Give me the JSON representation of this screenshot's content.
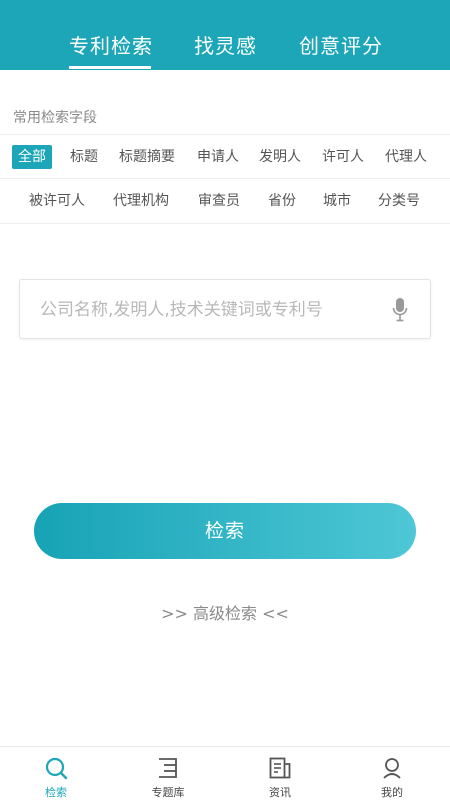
{
  "colors": {
    "accent": "#1ca6b8",
    "accent_light": "#4ec7d6"
  },
  "header": {
    "tabs": [
      {
        "label": "专利检索",
        "active": true
      },
      {
        "label": "找灵感",
        "active": false
      },
      {
        "label": "创意评分",
        "active": false
      }
    ]
  },
  "fields": {
    "label": "常用检索字段",
    "row1": [
      "全部",
      "标题",
      "标题摘要",
      "申请人",
      "发明人",
      "许可人",
      "代理人"
    ],
    "row2": [
      "被许可人",
      "代理机构",
      "审查员",
      "省份",
      "城市",
      "分类号"
    ],
    "selected": "全部"
  },
  "search": {
    "placeholder": "公司名称,发明人,技术关键词或专利号",
    "value": "",
    "icon": "microphone-icon",
    "button_label": "检索",
    "advanced_label": ">> 高级检索 <<"
  },
  "bottom_nav": [
    {
      "label": "检索",
      "icon": "search-icon",
      "active": true
    },
    {
      "label": "专题库",
      "icon": "topic-library-icon",
      "active": false
    },
    {
      "label": "资讯",
      "icon": "news-icon",
      "active": false
    },
    {
      "label": "我的",
      "icon": "profile-icon",
      "active": false
    }
  ]
}
